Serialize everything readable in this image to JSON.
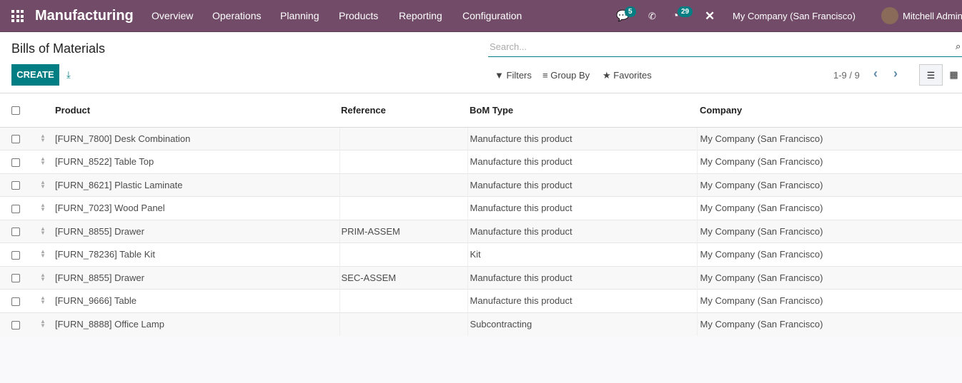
{
  "nav": {
    "brand": "Manufacturing",
    "menu": [
      "Overview",
      "Operations",
      "Planning",
      "Products",
      "Reporting",
      "Configuration"
    ],
    "messages_count": "5",
    "activities_count": "29",
    "company": "My Company (San Francisco)",
    "user": "Mitchell Admin"
  },
  "control": {
    "title": "Bills of Materials",
    "search_placeholder": "Search...",
    "create": "CREATE",
    "filters": "Filters",
    "group_by": "Group By",
    "favorites": "Favorites",
    "pager": "1-9 / 9"
  },
  "table": {
    "columns": [
      "Product",
      "Reference",
      "BoM Type",
      "Company"
    ],
    "rows": [
      [
        "[FURN_7800] Desk Combination",
        "",
        "Manufacture this product",
        "My Company (San Francisco)"
      ],
      [
        "[FURN_8522] Table Top",
        "",
        "Manufacture this product",
        "My Company (San Francisco)"
      ],
      [
        "[FURN_8621] Plastic Laminate",
        "",
        "Manufacture this product",
        "My Company (San Francisco)"
      ],
      [
        "[FURN_7023] Wood Panel",
        "",
        "Manufacture this product",
        "My Company (San Francisco)"
      ],
      [
        "[FURN_8855] Drawer",
        "PRIM-ASSEM",
        "Manufacture this product",
        "My Company (San Francisco)"
      ],
      [
        "[FURN_78236] Table Kit",
        "",
        "Kit",
        "My Company (San Francisco)"
      ],
      [
        "[FURN_8855] Drawer",
        "SEC-ASSEM",
        "Manufacture this product",
        "My Company (San Francisco)"
      ],
      [
        "[FURN_9666] Table",
        "",
        "Manufacture this product",
        "My Company (San Francisco)"
      ],
      [
        "[FURN_8888] Office Lamp",
        "",
        "Subcontracting",
        "My Company (San Francisco)"
      ]
    ]
  },
  "colors": {
    "nav": "#714b67",
    "accent": "#017e84"
  }
}
